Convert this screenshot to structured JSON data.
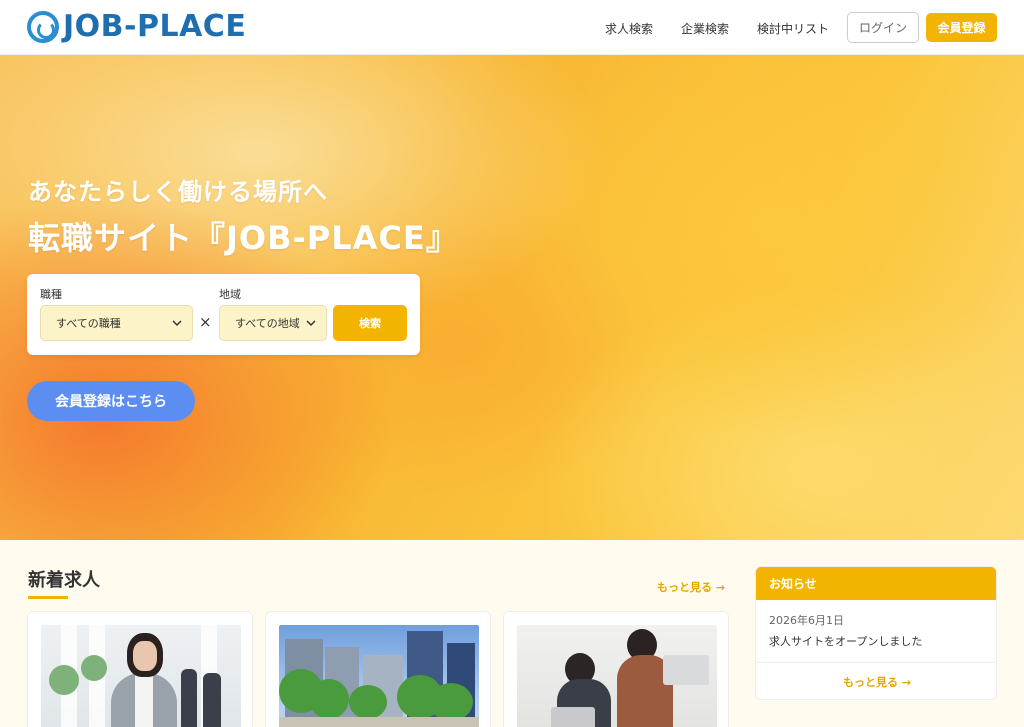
{
  "header": {
    "logo_text": "JOB-PLACE",
    "nav": [
      "求人検索",
      "企業検索",
      "検討中リスト"
    ],
    "login_label": "ログイン",
    "register_label": "会員登録"
  },
  "hero": {
    "subtitle": "あなたらしく働ける場所へ",
    "title": "転職サイト『JOB-PLACE』",
    "search": {
      "job_label": "職種",
      "job_value": "すべての職種",
      "area_label": "地域",
      "area_value": "すべての地域",
      "times": "×",
      "button_label": "検索"
    },
    "cta_label": "会員登録はこちら"
  },
  "jobs": {
    "title": "新着求人",
    "more_label": "もっと見る →"
  },
  "news": {
    "title": "お知らせ",
    "items": [
      {
        "date": "2026年6月1日",
        "text": "求人サイトをオープンしました"
      }
    ],
    "more_label": "もっと見る →"
  },
  "colors": {
    "accent": "#f2b400",
    "brand": "#1f6fb0",
    "cta": "#5b8ef0"
  }
}
